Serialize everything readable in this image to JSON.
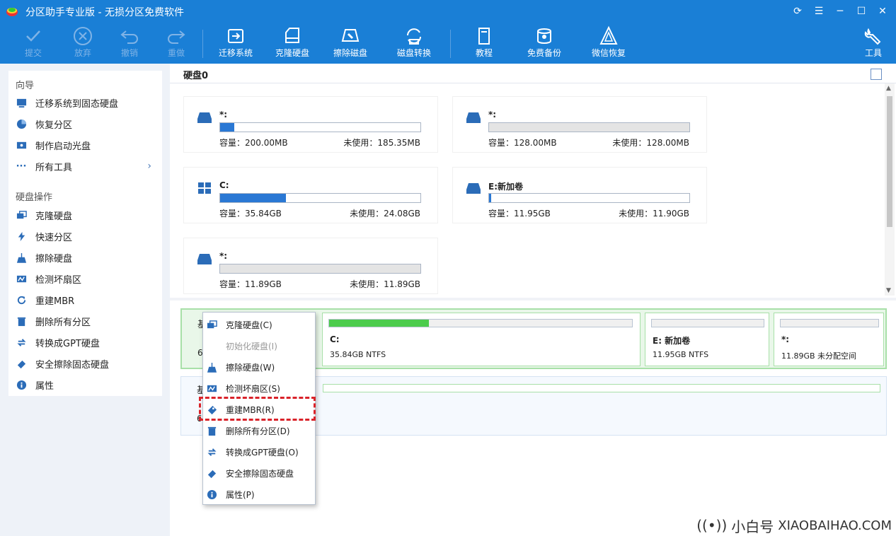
{
  "window": {
    "title": "分区助手专业版 - 无损分区免费软件",
    "controls": [
      "refresh",
      "menu",
      "minimize",
      "maximize",
      "close"
    ]
  },
  "toolbar": {
    "items": [
      {
        "name": "commit",
        "label": "提交",
        "enabled": false,
        "icon": "check-circle-icon"
      },
      {
        "name": "discard",
        "label": "放弃",
        "enabled": false,
        "icon": "x-circle-icon"
      },
      {
        "name": "undo",
        "label": "撤销",
        "enabled": false,
        "icon": "undo-arrow-icon"
      },
      {
        "name": "redo",
        "label": "重做",
        "enabled": false,
        "icon": "redo-arrow-icon"
      },
      {
        "name": "migrate-os",
        "label": "迁移系统",
        "enabled": true,
        "icon": "migrate-disk-icon"
      },
      {
        "name": "clone-disk",
        "label": "克隆硬盘",
        "enabled": true,
        "icon": "clone-disk-icon"
      },
      {
        "name": "wipe-disk",
        "label": "擦除磁盘",
        "enabled": true,
        "icon": "wipe-disk-icon"
      },
      {
        "name": "convert-disk",
        "label": "磁盘转换",
        "enabled": true,
        "icon": "convert-disk-icon"
      },
      {
        "name": "tutorial",
        "label": "教程",
        "enabled": true,
        "icon": "book-icon"
      },
      {
        "name": "free-backup",
        "label": "免费备份",
        "enabled": true,
        "icon": "backup-icon"
      },
      {
        "name": "wechat-recovery",
        "label": "微信恢复",
        "enabled": true,
        "icon": "recovery-icon"
      },
      {
        "name": "tools",
        "label": "工具",
        "enabled": true,
        "icon": "wrench-icon"
      }
    ]
  },
  "sidebar": {
    "wizard_title": "向导",
    "wizard_items": [
      {
        "label": "迁移系统到固态硬盘",
        "icon": "migrate-icon"
      },
      {
        "label": "恢复分区",
        "icon": "pie-icon"
      },
      {
        "label": "制作启动光盘",
        "icon": "bootdisk-icon"
      },
      {
        "label": "所有工具",
        "icon": "dots-icon",
        "has_arrow": true
      }
    ],
    "disk_ops_title": "硬盘操作",
    "disk_ops_items": [
      {
        "label": "克隆硬盘",
        "icon": "clone-icon"
      },
      {
        "label": "快速分区",
        "icon": "lightning-icon"
      },
      {
        "label": "擦除硬盘",
        "icon": "broom-icon"
      },
      {
        "label": "检测坏扇区",
        "icon": "scan-icon"
      },
      {
        "label": "重建MBR",
        "icon": "rebuild-icon"
      },
      {
        "label": "删除所有分区",
        "icon": "trash-icon"
      },
      {
        "label": "转换成GPT硬盘",
        "icon": "convert-icon"
      },
      {
        "label": "安全擦除固态硬盘",
        "icon": "eraser-icon"
      },
      {
        "label": "属性",
        "icon": "info-icon"
      }
    ]
  },
  "main": {
    "disk_label": "硬盘0",
    "partitions": [
      {
        "name": "*:",
        "capacity_label": "容量：200.00MB",
        "free_label": "未使用：185.35MB",
        "used_fraction": 0.07,
        "grey": false,
        "icon": "drive-icon"
      },
      {
        "name": "*:",
        "capacity_label": "容量：128.00MB",
        "free_label": "未使用：128.00MB",
        "used_fraction": 0,
        "grey": true,
        "icon": "drive-icon"
      },
      {
        "name": "C:",
        "capacity_label": "容量：35.84GB",
        "free_label": "未使用：24.08GB",
        "used_fraction": 0.33,
        "grey": false,
        "icon": "windows-icon"
      },
      {
        "name": "E:新加卷",
        "capacity_label": "容量：11.95GB",
        "free_label": "未使用：11.90GB",
        "used_fraction": 0.01,
        "grey": false,
        "icon": "drive-icon"
      },
      {
        "name": "*:",
        "capacity_label": "容量：11.89GB",
        "free_label": "未使用：11.89GB",
        "used_fraction": 0,
        "grey": true,
        "icon": "drive-icon"
      }
    ],
    "disk_map": {
      "left_text_1": "基",
      "left_text_2": "6",
      "segments": [
        {
          "name": "C:",
          "info": "35.84GB NTFS",
          "used_fraction": 0.33
        },
        {
          "name": "E: 新加卷",
          "info": "11.95GB NTFS",
          "used_fraction": 0.0
        },
        {
          "name": "*:",
          "info": "11.89GB 未分配空间",
          "used_fraction": 0.0
        }
      ]
    },
    "disk_map2": {
      "left_text_1": "基",
      "left_text_2": "6"
    }
  },
  "context_menu": {
    "items": [
      {
        "label": "克隆硬盘(C)",
        "enabled": true,
        "icon": "clone-icon"
      },
      {
        "label": "初始化硬盘(I)",
        "enabled": false,
        "icon": ""
      },
      {
        "label": "擦除硬盘(W)",
        "enabled": true,
        "icon": "broom-icon"
      },
      {
        "label": "检测坏扇区(S)",
        "enabled": true,
        "icon": "scan-icon"
      },
      {
        "label": "重建MBR(R)",
        "enabled": true,
        "icon": "rebuild-icon",
        "highlighted": true
      },
      {
        "label": "删除所有分区(D)",
        "enabled": true,
        "icon": "trash-icon"
      },
      {
        "label": "转换成GPT硬盘(O)",
        "enabled": true,
        "icon": "convert-icon"
      },
      {
        "label": "安全擦除固态硬盘",
        "enabled": true,
        "icon": "eraser-icon"
      },
      {
        "label": "属性(P)",
        "enabled": true,
        "icon": "info-icon"
      }
    ]
  },
  "watermark": {
    "brand": "小白号",
    "site": "XIAOBAIHAO.COM"
  },
  "colors": {
    "toolbar_bg": "#1a7fd6",
    "bar_fill": "#2a78d4",
    "map_green": "#4ccc4c",
    "highlight": "#d9232a"
  }
}
